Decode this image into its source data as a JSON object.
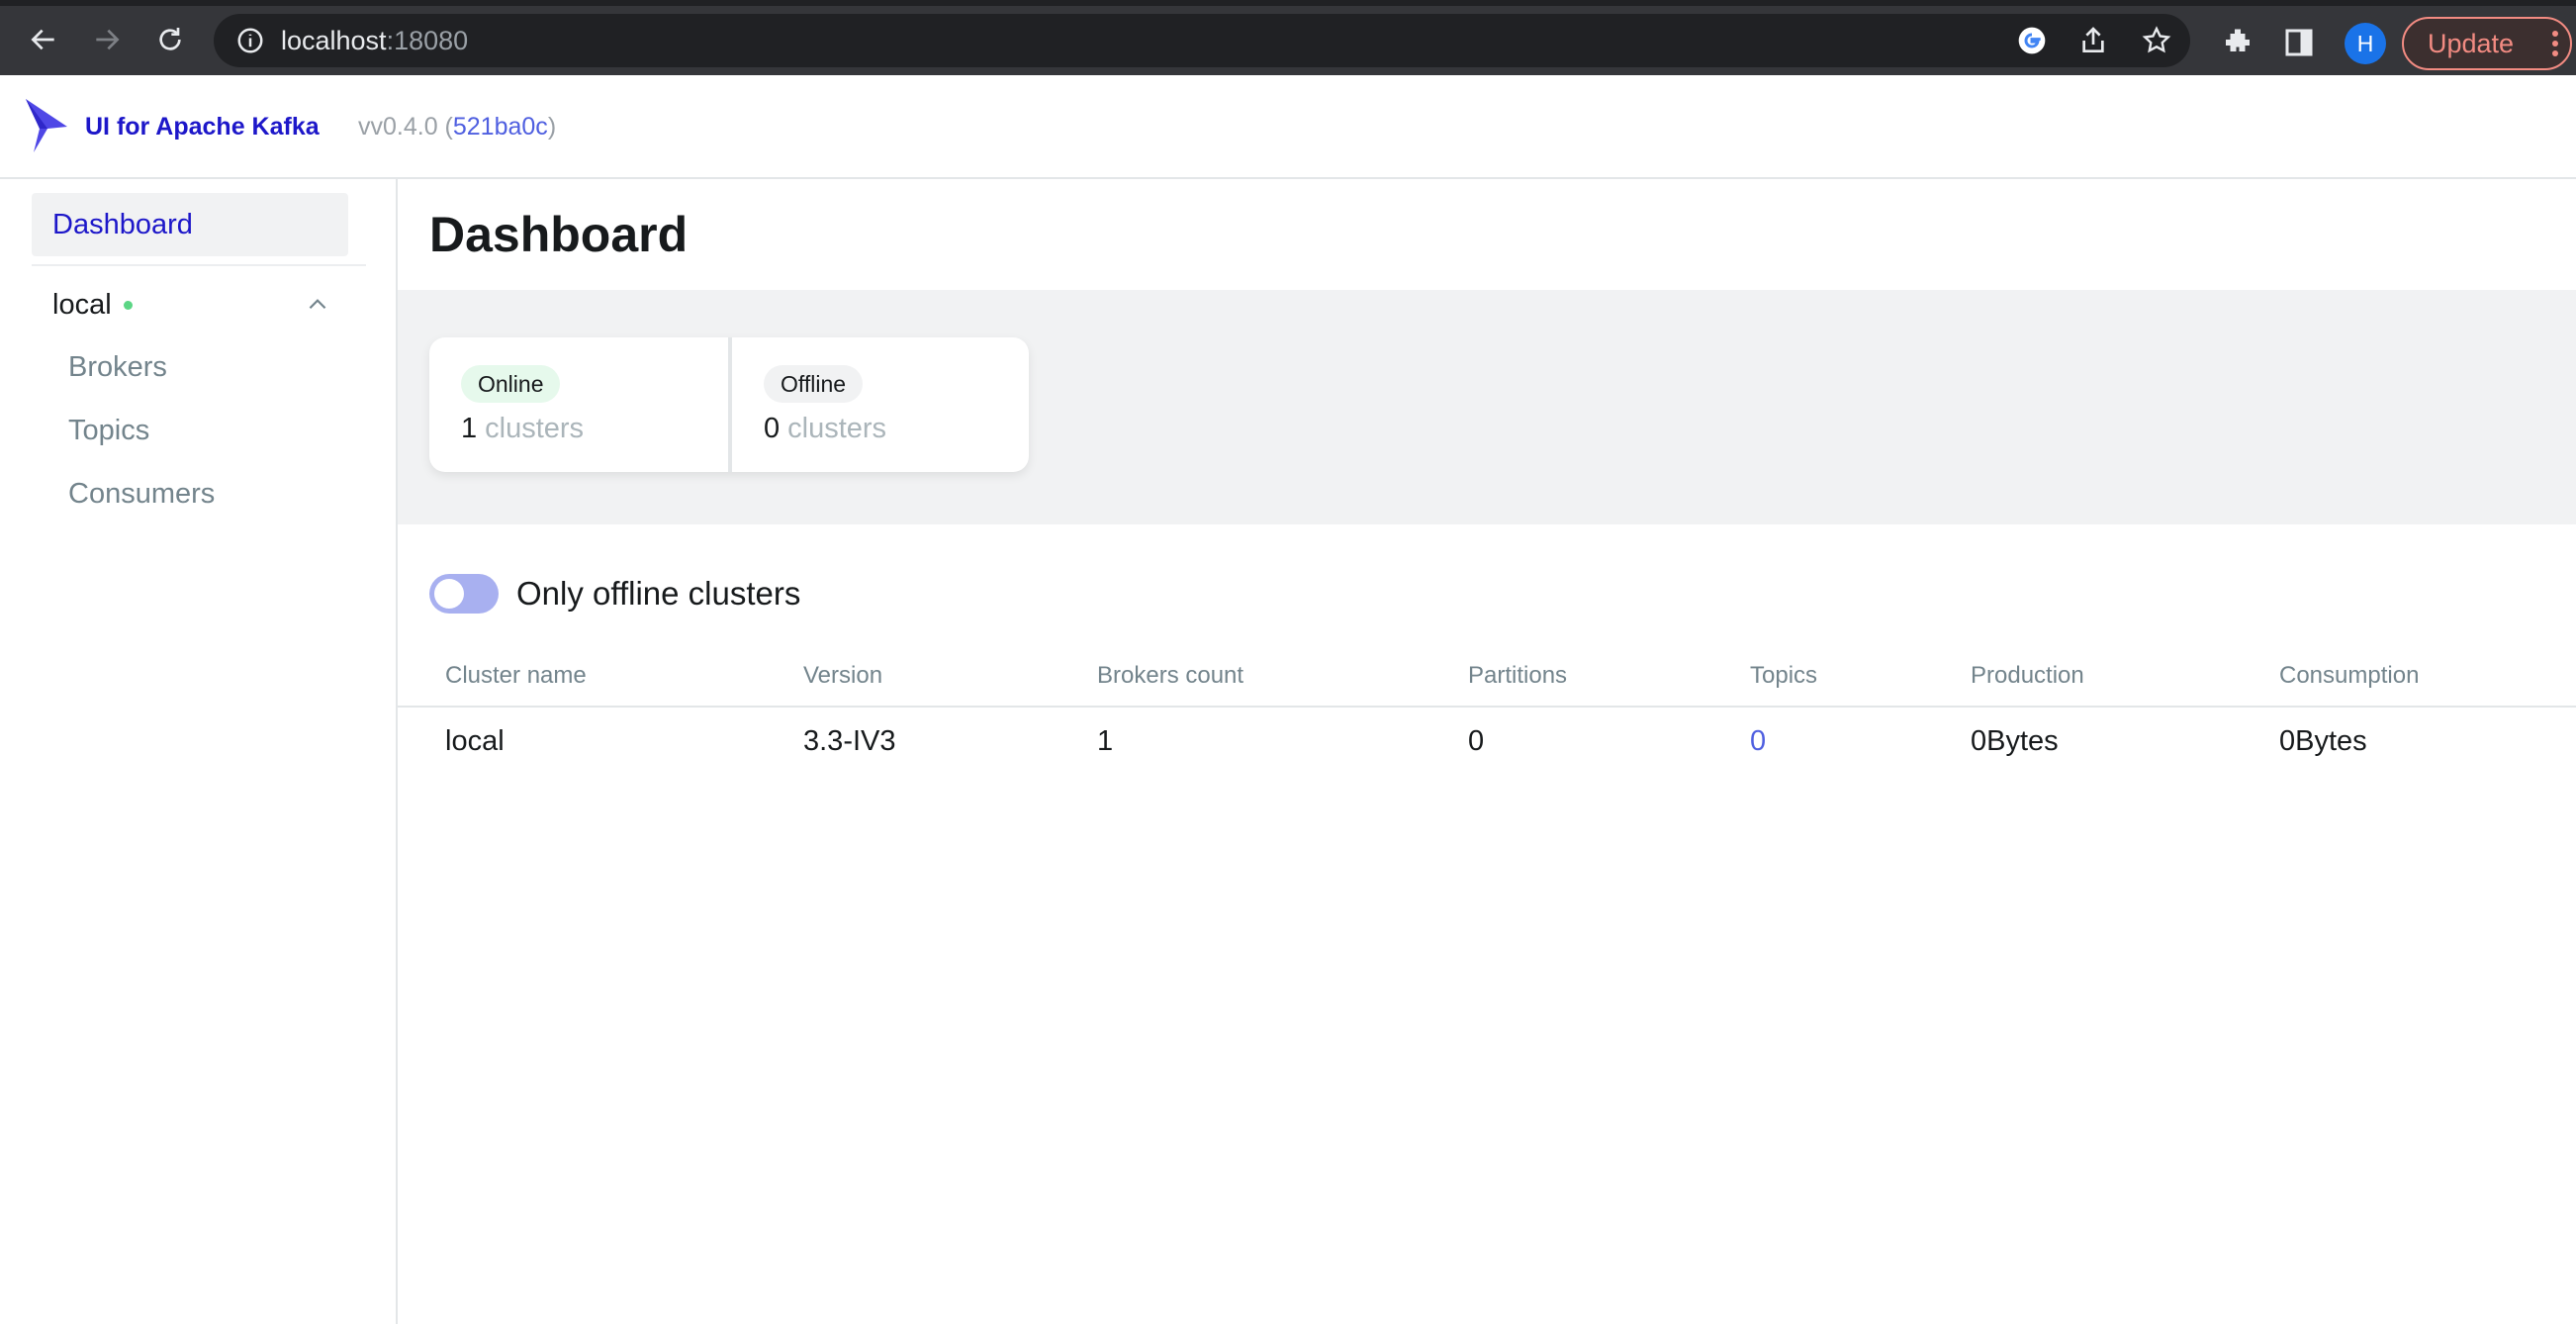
{
  "browser": {
    "url_host": "localhost",
    "url_port": ":18080",
    "profile_initial": "H",
    "update_label": "Update"
  },
  "header": {
    "app_name": "UI for Apache Kafka",
    "version_prefix": "vv0.4.0 (",
    "version_hash": "521ba0c",
    "version_suffix": ")"
  },
  "sidebar": {
    "dashboard_label": "Dashboard",
    "cluster_name": "local",
    "items": [
      {
        "label": "Brokers"
      },
      {
        "label": "Topics"
      },
      {
        "label": "Consumers"
      }
    ]
  },
  "main": {
    "title": "Dashboard",
    "stats": {
      "online_label": "Online",
      "online_count": "1",
      "offline_label": "Offline",
      "offline_count": "0",
      "unit": "clusters"
    },
    "toggle_label": "Only offline clusters",
    "table": {
      "columns": [
        "Cluster name",
        "Version",
        "Brokers count",
        "Partitions",
        "Topics",
        "Production",
        "Consumption"
      ],
      "rows": [
        [
          "local",
          "3.3-IV3",
          "1",
          "0",
          "0",
          "0Bytes",
          "0Bytes"
        ]
      ]
    }
  },
  "colors": {
    "brand": "#1d17c9",
    "link": "#4f5fe0",
    "online": "#5cd685"
  }
}
